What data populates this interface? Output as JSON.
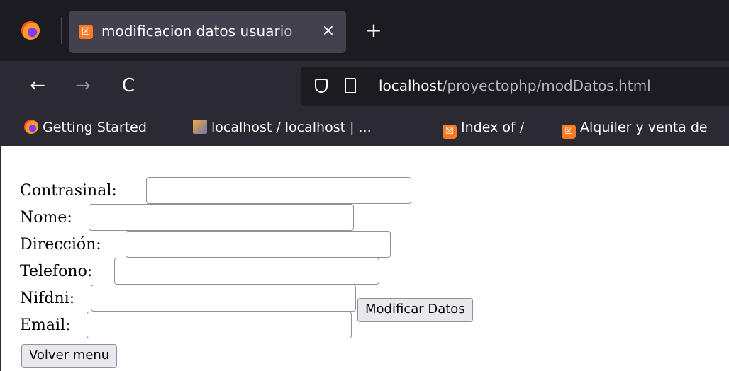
{
  "browser": {
    "tab": {
      "title": "modificacion datos usuario",
      "close": "×",
      "favicon": "ⓧ"
    },
    "new_tab": "+",
    "nav": {
      "back": "←",
      "forward": "→",
      "reload": "C"
    },
    "url": {
      "host": "localhost",
      "path": "/proyectophp/modDatos.html"
    },
    "bookmarks": [
      {
        "label": "Getting Started",
        "icon": "firefox-icon"
      },
      {
        "label": "localhost / localhost | ...",
        "icon": "phpmyadmin-icon"
      },
      {
        "label": "Index of /",
        "icon": "xampp-icon"
      },
      {
        "label": "Alquiler y venta de",
        "icon": "xampp-icon"
      }
    ]
  },
  "form": {
    "fields": [
      {
        "label": "Contrasinal:",
        "value": ""
      },
      {
        "label": "Nome:",
        "value": ""
      },
      {
        "label": "Dirección:",
        "value": ""
      },
      {
        "label": "Telefono:",
        "value": ""
      },
      {
        "label": "Nifdni:",
        "value": ""
      },
      {
        "label": "Email:",
        "value": ""
      }
    ],
    "submit_label": "Modificar Datos",
    "back_label": "Volver menu"
  }
}
